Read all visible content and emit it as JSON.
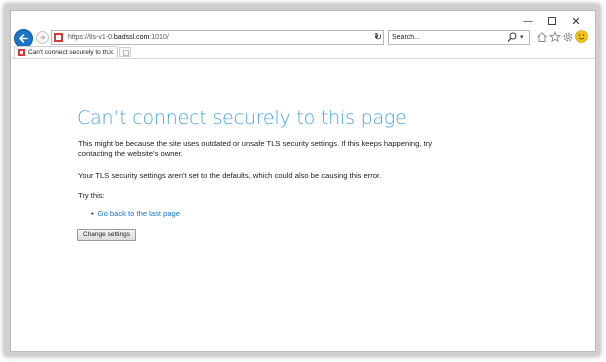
{
  "window": {
    "minimize": "—",
    "close": "✕"
  },
  "address_bar": {
    "url_prefix": "https://tls-v1-0.",
    "url_domain": "badssl.com",
    "url_suffix": ":1010/"
  },
  "search": {
    "placeholder": "Search..."
  },
  "tab": {
    "title": "Can't connect securely to th...",
    "close": "×"
  },
  "page": {
    "title": "Can’t connect securely to this page",
    "para1": "This might be because the site uses outdated or unsafe TLS security settings. If this keeps happening, try contacting the website's owner.",
    "para2": "Your TLS security settings aren't set to the defaults, which could also be causing this error.",
    "try_this": "Try this:",
    "go_back": "Go back to the last page",
    "change_settings": "Change settings"
  },
  "colors": {
    "accent": "#4aa3df",
    "link": "#1a74c8",
    "error": "#d23b3b"
  }
}
